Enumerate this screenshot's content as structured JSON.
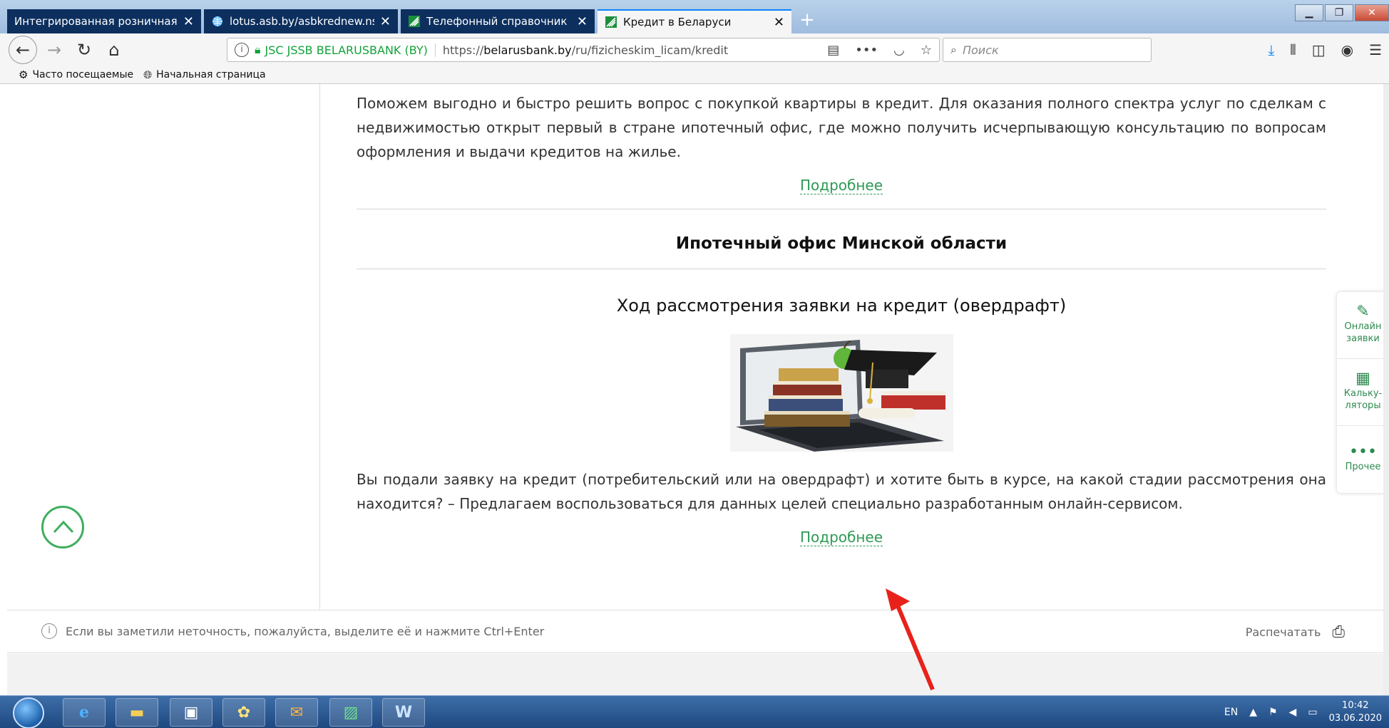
{
  "browser": {
    "tabs": [
      {
        "title": "Интегрированная розничная сист",
        "active": false
      },
      {
        "title": "lotus.asb.by/asbkrednew.nsf",
        "active": false
      },
      {
        "title": "Телефонный справочник ОА",
        "active": false
      },
      {
        "title": "Кредит в Беларуси",
        "active": true
      }
    ],
    "close_glyph": "✕",
    "new_tab_glyph": "+",
    "url_org": "JSC JSSB BELARUSBANK (BY)",
    "url_prefix": "https://",
    "url_domain": "belarusbank.by",
    "url_path": "/ru/fizicheskim_licam/kredit",
    "search_placeholder": "Поиск",
    "bookmarks": [
      {
        "label": "Часто посещаемые",
        "icon": "gear-icon"
      },
      {
        "label": "Начальная страница",
        "icon": "globe-icon"
      }
    ],
    "accent_color": "#0a84ff"
  },
  "page": {
    "mortgage_paragraph": "Поможем выгодно и быстро решить вопрос с покупкой квартиры в кредит. Для оказания полного спектра услуг по сделкам с недвижимостью открыт первый в стране ипотечный офис, где можно получить исчерпывающую консультацию по вопросам оформления и выдачи кредитов на жилье.",
    "more_label": "Подробнее",
    "office_heading": "Ипотечный офис Минской области",
    "section_heading": "Ход рассмотрения заявки на кредит (овердрафт)",
    "status_paragraph": "Вы подали заявку на кредит (потребительский или на овердрафт) и хотите быть в курсе, на какой стадии рассмотрения она находится? – Предлагаем воспользоваться для данных целей специально разработанным онлайн-сервисом.",
    "more_label_2": "Подробнее",
    "notice": "Если вы заметили неточность, пожалуйста, выделите её и нажмите Ctrl+Enter",
    "print_label": "Распечатать",
    "link_color": "#2d9a55"
  },
  "side_panel": [
    {
      "label_1": "Онлайн",
      "label_2": "заявки",
      "icon": "edit-icon"
    },
    {
      "label_1": "Кальку-",
      "label_2": "ляторы",
      "icon": "calculator-icon"
    },
    {
      "label_1": "",
      "label_2": "Прочее",
      "icon": "more-icon"
    }
  ],
  "taskbar": {
    "language": "EN",
    "time": "10:42",
    "date": "03.06.2020"
  }
}
